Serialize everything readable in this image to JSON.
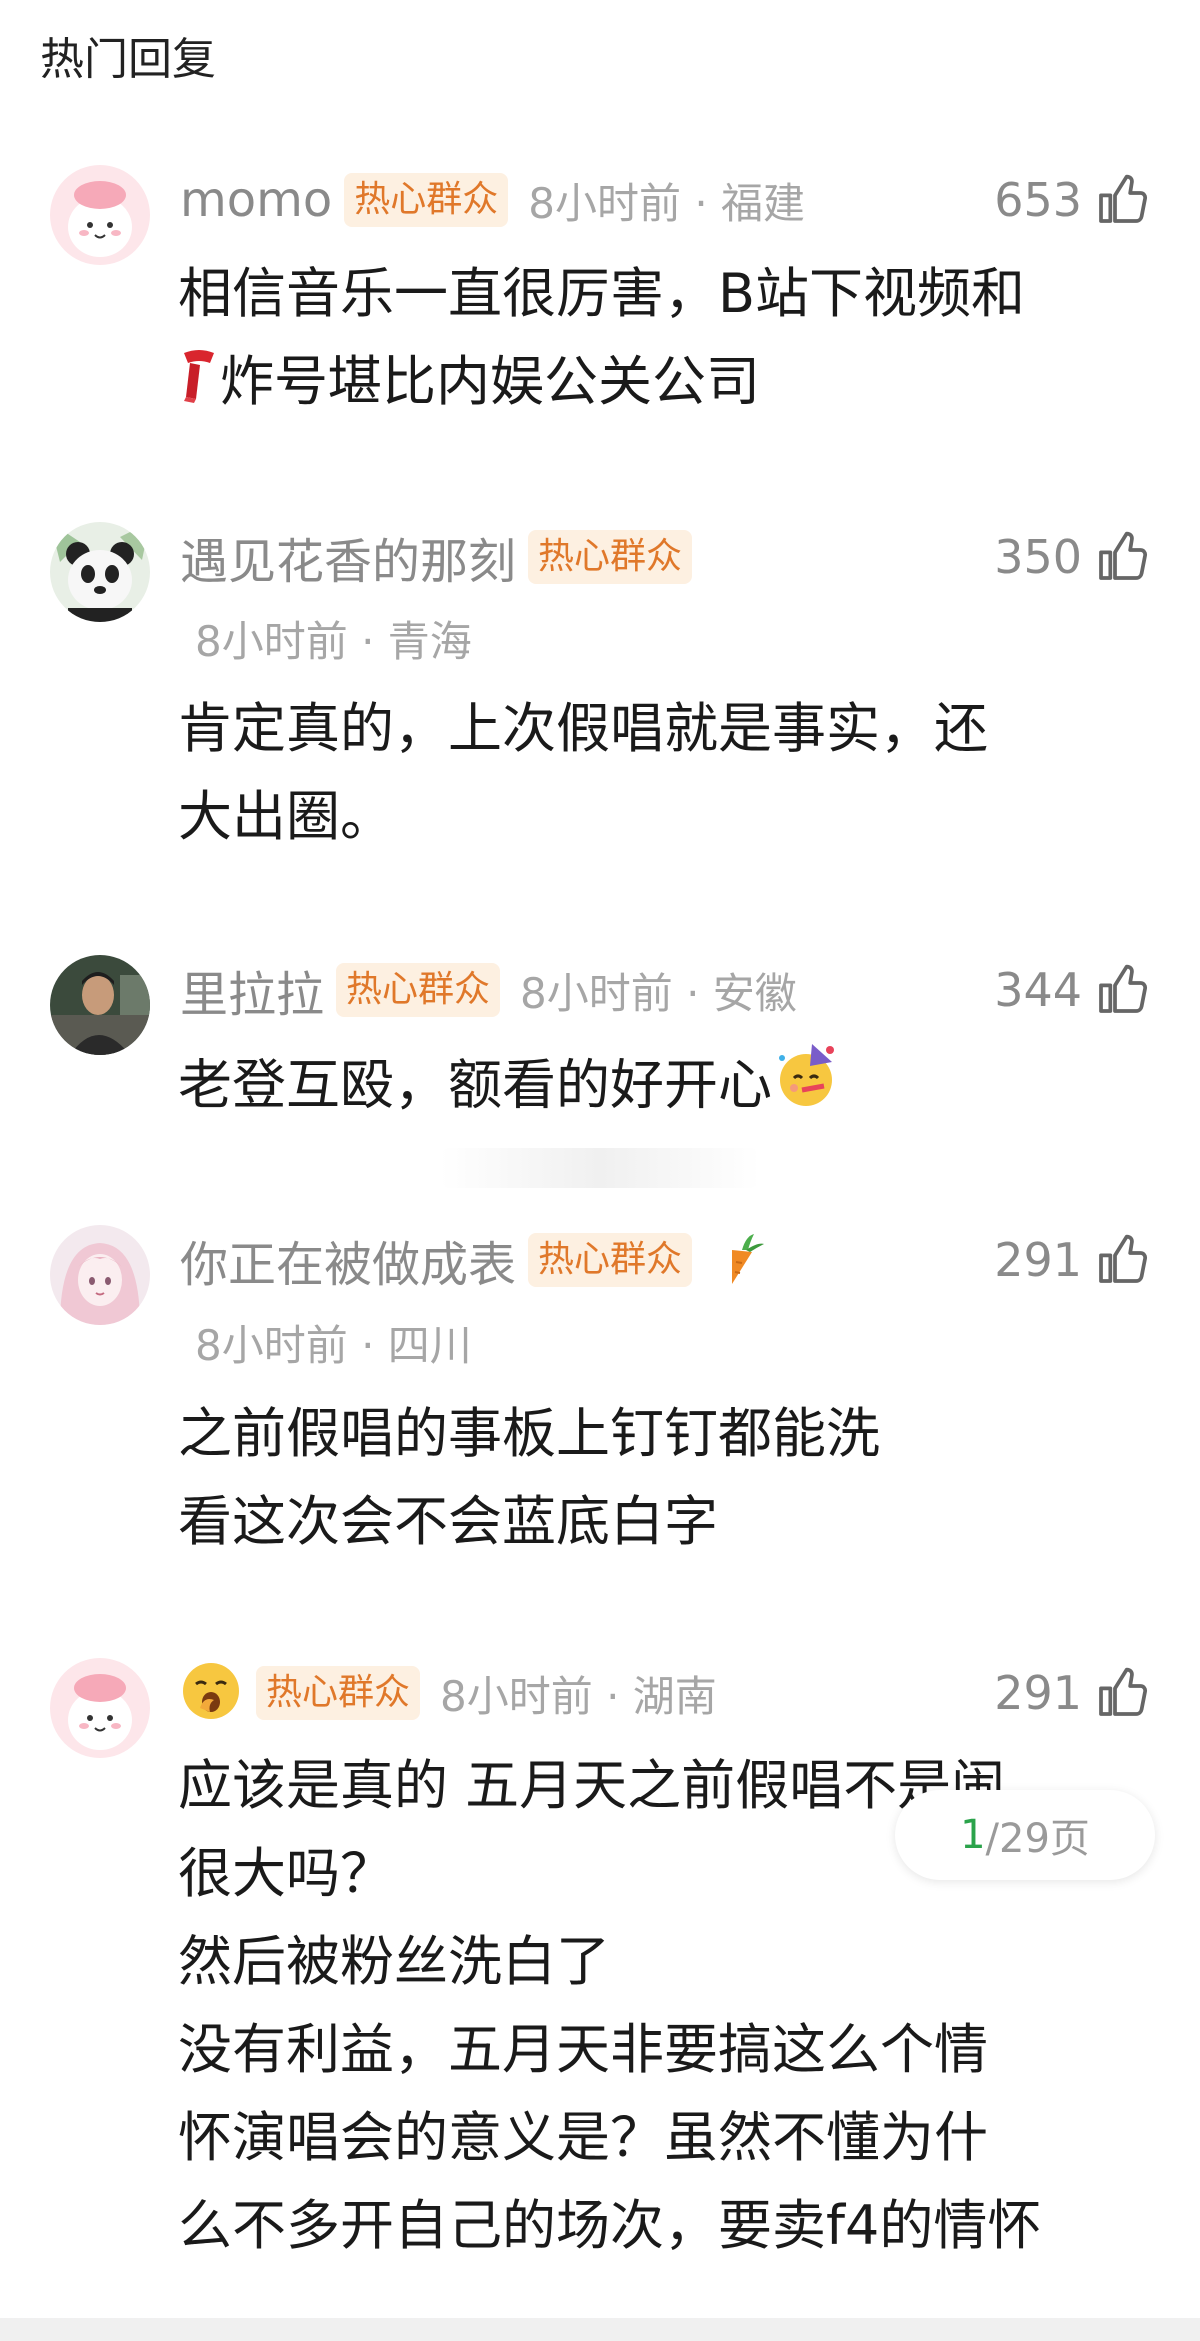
{
  "section": {
    "title": "热门回复"
  },
  "comments": [
    {
      "username": "momo",
      "badge": "热心群众",
      "meta": "8小时前 · 福建",
      "likes": "653",
      "lines": [
        "相信音乐一直很厉害，B站下视频和",
        "炸号堪比内娱公关公司"
      ],
      "avatar_icon": "pink-cartoon-avatar",
      "inline_emoji": "scarf-emoji"
    },
    {
      "username": "遇见花香的那刻",
      "badge": "热心群众",
      "meta": "8小时前 · 青海",
      "likes": "350",
      "lines": [
        "肯定真的，上次假唱就是事实，还",
        "大出圈。"
      ],
      "avatar_icon": "panda-avatar"
    },
    {
      "username": "里拉拉",
      "badge": "热心群众",
      "meta": "8小时前 · 安徽",
      "likes": "344",
      "lines": [
        "老登互殴，额看的好开心"
      ],
      "avatar_icon": "photo-avatar",
      "inline_emoji": "party-face-emoji"
    },
    {
      "username": "你正在被做成表",
      "badge": "热心群众",
      "meta": "8小时前 · 四川",
      "likes": "291",
      "lines": [
        "之前假唱的事板上钉钉都能洗",
        "看这次会不会蓝底白字"
      ],
      "avatar_icon": "anime-girl-avatar",
      "name_emoji": "carrot-emoji"
    },
    {
      "badge": "热心群众",
      "meta": "8小时前 · 湖南",
      "likes": "291",
      "lines": [
        "应该是真的 五月天之前假唱不是闹",
        "很大吗？",
        "然后被粉丝洗白了",
        "没有利益，五月天非要搞这么个情",
        "怀演唱会的意义是？虽然不懂为什",
        "么不多开自己的场次，要卖f4的情怀"
      ],
      "avatar_icon": "pink-cartoon-avatar",
      "name_emoji": "yawning-face-emoji"
    }
  ],
  "pager": {
    "current": "1",
    "rest": "/29页"
  },
  "colors": {
    "badge_text": "#e0782a",
    "badge_bg": "#fdf0e1",
    "meta": "#a6a6a6",
    "pager_current": "#2ba34b"
  }
}
